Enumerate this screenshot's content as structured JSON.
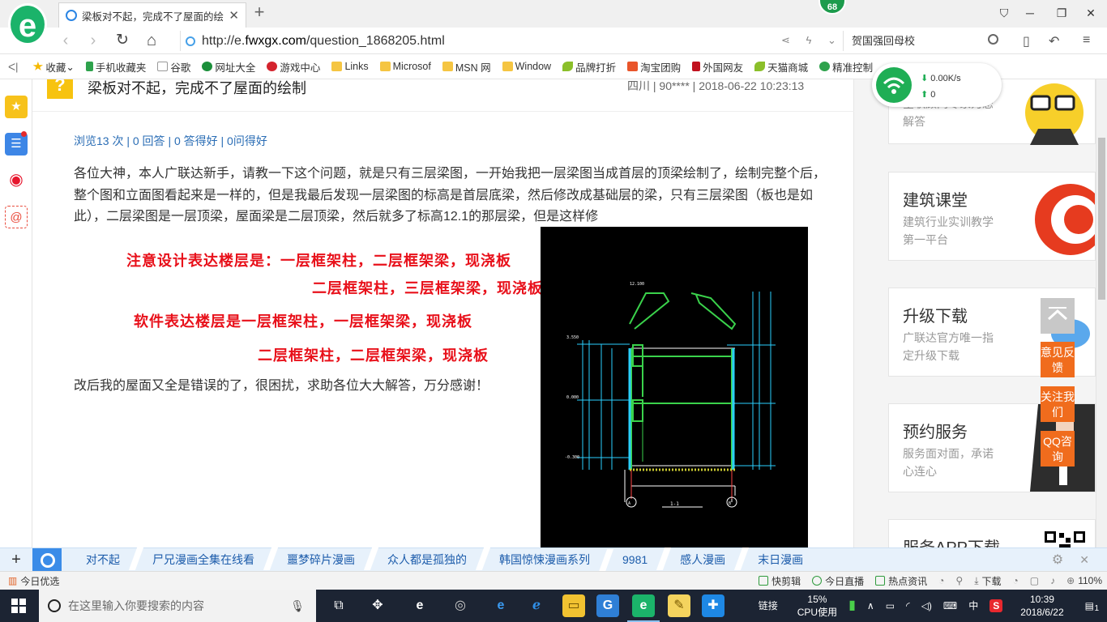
{
  "browser": {
    "tab_title": "梁板对不起，完成不了屋面的绘…",
    "notification_badge": "68",
    "url_prefix": "http://e.",
    "url_domain": "fwxgx.com",
    "url_path": "/question_1868205.html",
    "search_text": "贺国强回母校"
  },
  "bookmarks": [
    "收藏",
    "手机收藏夹",
    "谷歌",
    "网址大全",
    "游戏中心",
    "Links",
    "Microsof",
    "MSN 网",
    "Window",
    "品牌打折",
    "淘宝团购",
    "外国网友",
    "天猫商城",
    "精准控制"
  ],
  "question": {
    "title": "梁板对不起，完成不了屋面的绘制",
    "meta": "四川 | 90**** | 2018-06-22 10:23:13",
    "stats": "浏览13 次 | 0 回答 | 0 答得好 | 0问得好",
    "body": "各位大神，本人广联达新手，请教一下这个问题，就是只有三层梁图，一开始我把一层梁图当成首层的顶梁绘制了，绘制完整个后，整个图和立面图看起来是一样的，但是我最后发现一层梁图的标高是首层底梁，然后修改成基础层的梁，只有三层梁图（板也是如此），二层梁图是一层顶梁，屋面梁是二层顶梁，然后就多了标高12.1的那层梁，但是这样修",
    "red_lines": [
      "注意设计表达楼层是：一层框架柱，二层框架梁，现浇板",
      "二层框架柱，三层框架梁，现浇板",
      "软件表达楼层是一层框架柱，一层框架梁，现浇板",
      "二层框架柱，二层框架梁，现浇板"
    ],
    "closing": "改后我的屋面又全是错误的了，很困扰，求助各位大大解答，万分感谢！"
  },
  "sidebar_cards": [
    {
      "title": "",
      "subtitle": "全职顾问专家为您解答"
    },
    {
      "title": "建筑课堂",
      "subtitle": "建筑行业实训教学第一平台"
    },
    {
      "title": "升级下载",
      "subtitle": "广联达官方唯一指定升级下载"
    },
    {
      "title": "预约服务",
      "subtitle": "服务面对面，承诺心连心"
    },
    {
      "title": "服务APP下载",
      "subtitle": ""
    }
  ],
  "float_buttons": [
    "意见反馈",
    "关注我们",
    "QQ咨询"
  ],
  "net_widget": {
    "speed": "0.00K/s",
    "count": "0"
  },
  "hot_searches": [
    "对不起",
    "尸兄漫画全集在线看",
    "噩梦碎片漫画",
    "众人都是孤独的",
    "韩国惊悚漫画系列",
    "9981",
    "感人漫画",
    "末日漫画"
  ],
  "statusbar": {
    "left": "今日优选",
    "items": [
      "快剪辑",
      "今日直播",
      "热点资讯",
      "下载"
    ],
    "zoom": "110%"
  },
  "taskbar": {
    "search_placeholder": "在这里输入你要搜索的内容",
    "link_label": "链接",
    "cpu_percent": "15%",
    "cpu_label": "CPU使用",
    "ime": "中",
    "time": "10:39",
    "date": "2018/6/22",
    "notifications": "1"
  },
  "colors": {
    "red_text": "#e8101a",
    "link": "#2a6db5",
    "accent_orange": "#f06c1d",
    "logo_green": "#1bb36a"
  }
}
